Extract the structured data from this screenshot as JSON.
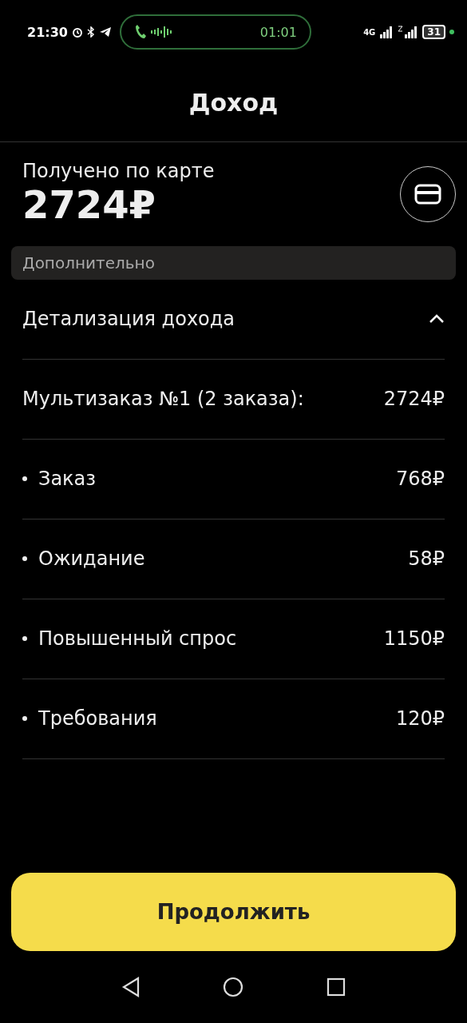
{
  "status_bar": {
    "time": "21:30",
    "call_timer": "01:01",
    "network": "4G",
    "battery": "31"
  },
  "header": {
    "title": "Доход"
  },
  "summary": {
    "label": "Получено по карте",
    "amount": "2724₽"
  },
  "section": {
    "title": "Дополнительно"
  },
  "details": {
    "title": "Детализация дохода",
    "expanded": true,
    "rows": [
      {
        "kind": "total",
        "label": "Мультизаказ №1 (2 заказа):",
        "amount": "2724₽"
      },
      {
        "kind": "item",
        "label": "Заказ",
        "amount": "768₽"
      },
      {
        "kind": "item",
        "label": "Ожидание",
        "amount": "58₽"
      },
      {
        "kind": "item",
        "label": "Повышенный спрос",
        "amount": "1150₽"
      },
      {
        "kind": "item",
        "label": "Требования",
        "amount": "120₽"
      }
    ]
  },
  "continue_button": "Продолжить"
}
